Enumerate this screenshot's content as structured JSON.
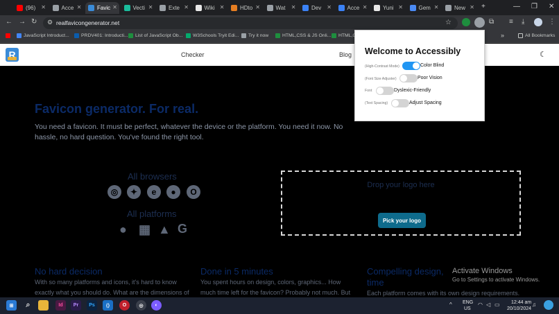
{
  "browser": {
    "tabs": [
      {
        "label": "(96)",
        "icon": "youtube-icon",
        "color": "#ff0000"
      },
      {
        "label": "Acce",
        "icon": "globe-icon",
        "color": "#9aa0a6"
      },
      {
        "label": "Favic",
        "icon": "favicon-generator-icon",
        "color": "#3a8bd8",
        "active": true
      },
      {
        "label": "Vecti",
        "icon": "vector-icon",
        "color": "#1abc9c"
      },
      {
        "label": "Exte",
        "icon": "puzzle-icon",
        "color": "#9aa0a6"
      },
      {
        "label": "Wiki",
        "icon": "wikipedia-icon",
        "color": "#e8e8e8"
      },
      {
        "label": "HDto",
        "icon": "hd-icon",
        "color": "#e67e22"
      },
      {
        "label": "Wat",
        "icon": "watch-icon",
        "color": "#9aa0a6"
      },
      {
        "label": "Dev",
        "icon": "dev-icon",
        "color": "#3b82f6"
      },
      {
        "label": "Acce",
        "icon": "dev-icon",
        "color": "#3b82f6"
      },
      {
        "label": "Yuni",
        "icon": "github-icon",
        "color": "#e8e8e8"
      },
      {
        "label": "Gem",
        "icon": "gemini-icon",
        "color": "#4b8bf5"
      },
      {
        "label": "New",
        "icon": "globe-icon",
        "color": "#9aa0a6"
      }
    ],
    "new_tab": "+",
    "url": "realfavicongenerator.net",
    "bookmarks": [
      {
        "label": "",
        "color": "#ff0000"
      },
      {
        "label": "JavaScript Introduct...",
        "color": "#4285f4"
      },
      {
        "label": "PRDV401: Introducti...",
        "color": "#0b5cad"
      },
      {
        "label": "List of JavaScript Ob...",
        "color": "#1e8e3e"
      },
      {
        "label": "W3Schools Tryit Edi...",
        "color": "#04aa6d"
      },
      {
        "label": "Try it now",
        "color": "#9aa0a6"
      },
      {
        "label": "HTML,CSS & JS Onli...",
        "color": "#1e8e3e"
      },
      {
        "label": "HTML,CS",
        "color": "#1e8e3e"
      }
    ],
    "all_bookmarks": "All Bookmarks",
    "more_bookmarks": "»"
  },
  "site": {
    "nav_checker": "Checker",
    "nav_blog": "Blog",
    "hero_title": "Favicon generator. For real.",
    "hero_sub": "You need a favicon. It must be perfect, whatever the device or the platform. You need it now. No hassle, no hard question. You've found the right tool.",
    "all_browsers": "All browsers",
    "all_platforms": "All platforms",
    "drop_text": "Drop your logo here",
    "pick_button": "Pick your logo",
    "features": [
      {
        "title": "No hard decision",
        "body": "With so many platforms and icons, it's hard to know exactly what you should do. What are the dimensions of"
      },
      {
        "title": "Done in 5 minutes",
        "body": "You spent hours on design, colors, graphics... How much time left for the favicon? Probably not much. But"
      },
      {
        "title": "Compelling design,",
        "title2": "time",
        "body": "Each platform comes with its own design requirements."
      }
    ]
  },
  "popup": {
    "title": "Welcome to Accessibly",
    "options": [
      {
        "tag": "(High-Contrast Mode)",
        "label": "Color Blind",
        "on": true
      },
      {
        "tag": "(Font Size Adjuster)",
        "label": "Poor Vision",
        "on": false
      },
      {
        "tag": "Font",
        "label": "Dyslexic-Friendly",
        "on": false
      },
      {
        "tag": "(Text Spacing)",
        "label": "Adjust Spacing",
        "on": false
      }
    ]
  },
  "windows": {
    "activate_title": "Activate Windows",
    "activate_sub": "Go to Settings to activate Windows.",
    "lang": "ENG",
    "region": "US",
    "time": "12:44 am",
    "date": "20/10/2024"
  }
}
